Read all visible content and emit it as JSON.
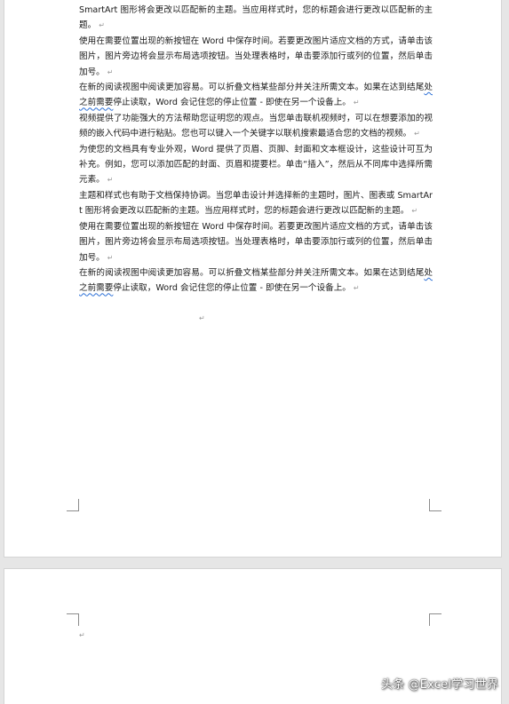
{
  "document": {
    "page1": {
      "paragraphs": [
        {
          "text": "SmartArt 图形将会更改以匹配新的主题。当应用样式时，您的标题会进行更改以匹配新的主题。",
          "mark": "↵"
        },
        {
          "text": "使用在需要位置出现的新按钮在 Word 中保存时间。若要更改图片适应文档的方式，请单击该图片，图片旁边将会显示布局选项按钮。当处理表格时，单击要添加行或列的位置，然后单击加号。",
          "mark": "↵"
        },
        {
          "pre": "在新的阅读视图中阅读更加容易。可以折叠文档某些部分并关注所需文本。如果在达到结尾",
          "squiggle": "处之前需要",
          "post": "停止读取，Word 会记住您的停止位置 - 即使在另一个设备上。",
          "mark": "↵"
        },
        {
          "text": "视频提供了功能强大的方法帮助您证明您的观点。当您单击联机视频时，可以在想要添加的视频的嵌入代码中进行粘贴。您也可以键入一个关键字以联机搜索最适合您的文档的视频。",
          "mark": "↵"
        },
        {
          "text": "为使您的文档具有专业外观，Word 提供了页眉、页脚、封面和文本框设计，这些设计可互为补充。例如，您可以添加匹配的封面、页眉和提要栏。单击“插入”，然后从不同库中选择所需元素。",
          "mark": "↵"
        },
        {
          "text": "主题和样式也有助于文档保持协调。当您单击设计并选择新的主题时，图片、图表或 SmartArt 图形将会更改以匹配新的主题。当应用样式时，您的标题会进行更改以匹配新的主题。",
          "mark": "↵"
        },
        {
          "text": "使用在需要位置出现的新按钮在 Word 中保存时间。若要更改图片适应文档的方式，请单击该图片，图片旁边将会显示布局选项按钮。当处理表格时，单击要添加行或列的位置，然后单击加号。",
          "mark": "↵"
        },
        {
          "pre": "在新的阅读视图中阅读更加容易。可以折叠文档某些部分并关注所需文本。如果在达到结尾",
          "squiggle": "处之前需要",
          "post": "停止读取，Word 会记住您的停止位置 - 即使在另一个设备上。",
          "mark": "↵"
        }
      ],
      "empty_paragraph_mark": "↵"
    },
    "page2": {
      "empty_paragraph_mark": "↵"
    }
  },
  "watermark": {
    "text": "头条 @Excel学习世界"
  },
  "colors": {
    "canvas": "#e6e6e6",
    "page": "#ffffff",
    "text": "#1a1a1a",
    "formatting_mark": "#9a9a9a",
    "grammar_squiggle": "#2b6fd6",
    "crop_mark": "#8c8c8c"
  }
}
